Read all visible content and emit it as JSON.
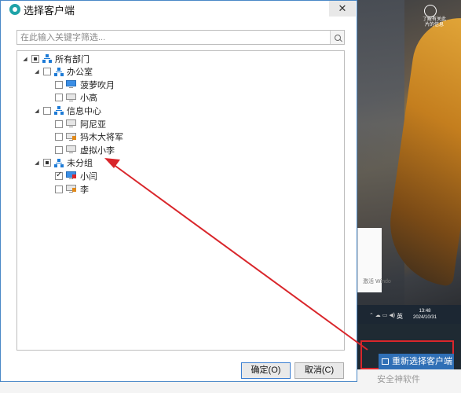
{
  "dialog": {
    "title": "选择客户端",
    "close_label": "✕",
    "search_placeholder": "在此输入关键字筛选...",
    "ok_label": "确定(O)",
    "cancel_label": "取消(C)"
  },
  "tree": [
    {
      "label": "所有部门",
      "kind": "org",
      "check": "partial",
      "expander": "◢"
    },
    {
      "label": "办公室",
      "kind": "org",
      "check": "none",
      "expander": "◢"
    },
    {
      "label": "菠萝吹月",
      "kind": "pc-online",
      "check": "none"
    },
    {
      "label": "小高",
      "kind": "pc",
      "check": "none"
    },
    {
      "label": "信息中心",
      "kind": "org",
      "check": "none",
      "expander": "◢"
    },
    {
      "label": "阿尼亚",
      "kind": "pc",
      "check": "none"
    },
    {
      "label": "犸木大将军",
      "kind": "pc-lock",
      "check": "none"
    },
    {
      "label": "虚拟小李",
      "kind": "pc",
      "check": "none"
    },
    {
      "label": "未分组",
      "kind": "org",
      "check": "partial",
      "expander": "◢"
    },
    {
      "label": "小闫",
      "kind": "pc-online-red",
      "check": "checked"
    },
    {
      "label": "李",
      "kind": "pc-lock",
      "check": "none"
    }
  ],
  "reselect_button": {
    "label": "重新选择客户端"
  },
  "watermark": "安全神软件",
  "taskbar": {
    "ime": "英",
    "time": "13:48",
    "date": "2024/10/31"
  },
  "inner_window_text": "激活 Windo",
  "desktop_caption": "了解有关此\n片的信息",
  "colors": {
    "accent": "#2f6fb6",
    "highlight_border": "#d9262b",
    "arrow": "#d9262b"
  }
}
